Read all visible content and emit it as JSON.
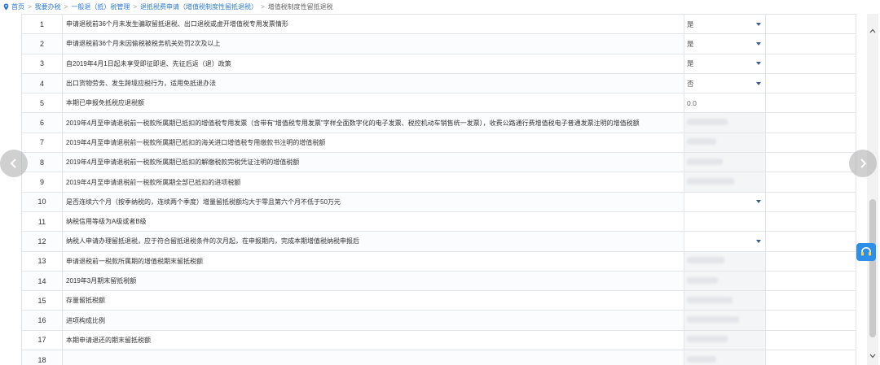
{
  "breadcrumb": {
    "items": [
      "首页",
      "我要办税",
      "一般退（抵）税管理",
      "退抵税费申请（增值税制度性留抵退税）",
      "增值税制度性留抵退税"
    ],
    "separator": ">"
  },
  "table": {
    "rows": [
      {
        "no": "1",
        "item": "申请退税前36个月未发生骗取留抵退税、出口退税或虚开增值税专用发票情形",
        "value": "是",
        "control": "select"
      },
      {
        "no": "2",
        "item": "申请退税前36个月未因偷税被税务机关处罚2次及以上",
        "value": "是",
        "control": "select"
      },
      {
        "no": "3",
        "item": "自2019年4月1日起未享受即征即退、先征后返（退）政策",
        "value": "是",
        "control": "select"
      },
      {
        "no": "4",
        "item": "出口货物劳务、发生跨境应税行为，适用免抵退办法",
        "value": "否",
        "control": "select"
      },
      {
        "no": "5",
        "item": "本期已申报免抵税应退税额",
        "value": "0.0",
        "control": "text"
      },
      {
        "no": "6",
        "item": "2019年4月至申请退税前一税款所属期已抵扣的增值税专用发票（含带有“增值税专用发票”字样全面数字化的电子发票、税控机动车销售统一发票），收费公路通行费增值税电子普通发票注明的增值税额",
        "value": "",
        "control": "blurred"
      },
      {
        "no": "7",
        "item": "2019年4月至申请退税前一税款所属期已抵扣的海关进口增值税专用缴款书注明的增值税额",
        "value": "",
        "control": "blurred"
      },
      {
        "no": "8",
        "item": "2019年4月至申请退税前一税款所属期已抵扣的解缴税款完税凭证注明的增值税额",
        "value": "",
        "control": "blurred"
      },
      {
        "no": "9",
        "item": "2019年4月至申请退税前一税款所属期全部已抵扣的进项税额",
        "value": "",
        "control": "blurred"
      },
      {
        "no": "10",
        "item": "是否连续六个月（按季纳税的，连续两个季度）增量留抵税额均大于零且第六个月不低于50万元",
        "value": "",
        "control": "select-empty"
      },
      {
        "no": "11",
        "item": "纳税信用等级为A级或者B级",
        "value": "",
        "control": "empty"
      },
      {
        "no": "12",
        "item": "纳税人申请办理留抵退税，应于符合留抵退税条件的次月起，在申报期内，完成本期增值税纳税申报后",
        "value": "",
        "control": "select-empty"
      },
      {
        "no": "13",
        "item": "申请退税前一税款所属期的增值税期末留抵税额",
        "value": "",
        "control": "blurred"
      },
      {
        "no": "14",
        "item": "2019年3月期末留抵税额",
        "value": "",
        "control": "blurred"
      },
      {
        "no": "15",
        "item": "存量留抵税额",
        "value": "",
        "control": "blurred"
      },
      {
        "no": "16",
        "item": "进项构成比例",
        "value": "",
        "control": "blurred"
      },
      {
        "no": "17",
        "item": "本期申请退还的期末留抵税额",
        "value": "",
        "control": "blurred"
      },
      {
        "no": "18",
        "item": "",
        "value": "",
        "control": "blurred"
      }
    ]
  },
  "colors": {
    "link": "#2b79d4",
    "border": "#e2e6ea",
    "help_button": "#2d8fe8",
    "caret": "#3a5b96"
  },
  "icons": {
    "home": "location-pin-icon",
    "prev": "chevron-left-icon",
    "next": "chevron-right-icon",
    "help": "headset-icon"
  }
}
